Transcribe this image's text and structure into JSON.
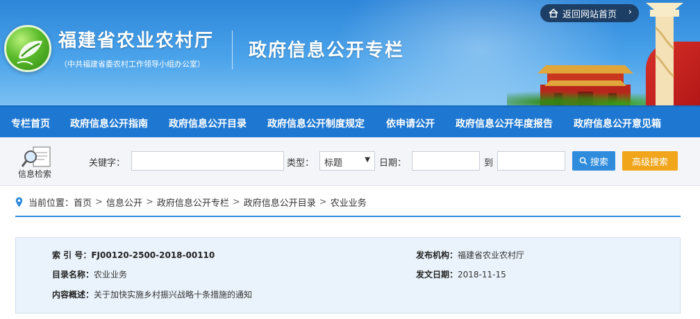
{
  "header": {
    "site_title": "福建省农业农村厅",
    "site_subtitle": "（中共福建省委农村工作领导小组办公室）",
    "column_title": "政府信息公开专栏",
    "back_button_label": "返回网站首页",
    "back_icon": "home-icon"
  },
  "nav": {
    "items": [
      {
        "label": "专栏首页"
      },
      {
        "label": "政府信息公开指南"
      },
      {
        "label": "政府信息公开目录"
      },
      {
        "label": "政府信息公开制度规定"
      },
      {
        "label": "依申请公开"
      },
      {
        "label": "政府信息公开年度报告"
      },
      {
        "label": "政府信息公开意见箱"
      }
    ]
  },
  "search": {
    "section_label": "信息检索",
    "keyword_label": "关键字：",
    "keyword_value": "",
    "type_label": "类型：",
    "type_selected": "标题",
    "date_label": "日期：",
    "date_from": "",
    "date_to_label": "到",
    "date_to": "",
    "search_button": "搜索",
    "advanced_button": "高级搜索"
  },
  "breadcrumb": {
    "prefix": "当前位置：",
    "items": [
      "首页",
      "信息公开",
      "政府信息公开专栏",
      "政府信息公开目录",
      "农业业务"
    ],
    "separator": ">"
  },
  "info": {
    "index_label": "索 引 号：",
    "index_value": "FJ00120-2500-2018-00110",
    "publisher_label": "发布机构：",
    "publisher_value": "福建省农业农村厅",
    "catalog_label": "目录名称：",
    "catalog_value": "农业业务",
    "date_label": "发文日期：",
    "date_value": "2018-11-15",
    "summary_label": "内容概述：",
    "summary_value": "关于加快实施乡村振兴战略十条措施的通知"
  },
  "colors": {
    "nav_bg": "#1e78d2",
    "search_button": "#2f8bdc",
    "advanced_button": "#f0a51a",
    "info_bg": "#eaf3fb"
  }
}
